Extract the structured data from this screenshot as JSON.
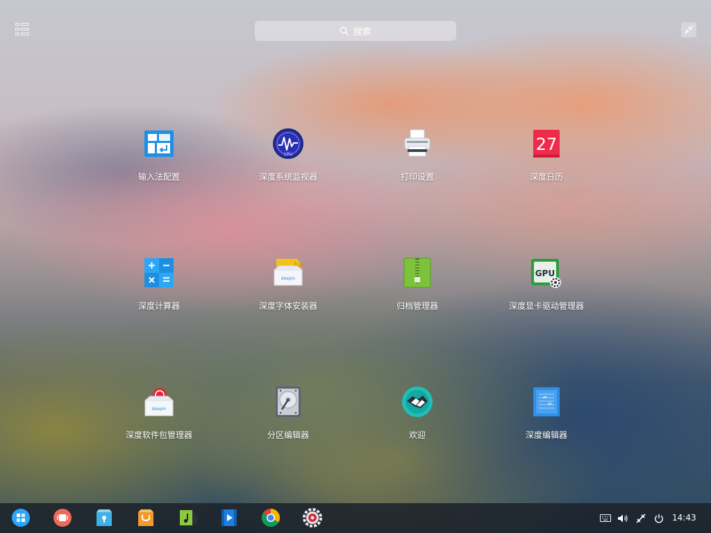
{
  "launcher": {
    "search_placeholder": "搜索",
    "apps": [
      {
        "label": "输入法配置",
        "icon": "keyboard-config-icon"
      },
      {
        "label": "深度系统监视器",
        "icon": "system-monitor-icon"
      },
      {
        "label": "打印设置",
        "icon": "printer-icon"
      },
      {
        "label": "深度日历",
        "icon": "calendar-icon",
        "icon_text": "27"
      },
      {
        "label": "深度计算器",
        "icon": "calculator-icon"
      },
      {
        "label": "深度字体安装器",
        "icon": "font-installer-icon"
      },
      {
        "label": "归档管理器",
        "icon": "archive-manager-icon"
      },
      {
        "label": "深度显卡驱动管理器",
        "icon": "gpu-driver-icon",
        "icon_text": "GPU"
      },
      {
        "label": "深度软件包管理器",
        "icon": "package-manager-icon"
      },
      {
        "label": "分区编辑器",
        "icon": "partition-editor-icon"
      },
      {
        "label": "欢迎",
        "icon": "welcome-icon"
      },
      {
        "label": "深度编辑器",
        "icon": "text-editor-icon"
      }
    ],
    "icon_badges": {
      "cpu": "CPU",
      "deepin": "deepin"
    }
  },
  "dock": {
    "apps": [
      "launcher-icon",
      "multitasking-icon",
      "file-manager-icon",
      "app-store-icon",
      "music-icon",
      "movie-icon",
      "chrome-icon",
      "settings-icon"
    ],
    "tray": [
      "keyboard-layout-icon",
      "volume-icon",
      "network-icon",
      "power-icon"
    ],
    "clock": "14:43"
  },
  "colors": {
    "accent": "#2ca7f8",
    "dock_bg": "#1c222a"
  }
}
